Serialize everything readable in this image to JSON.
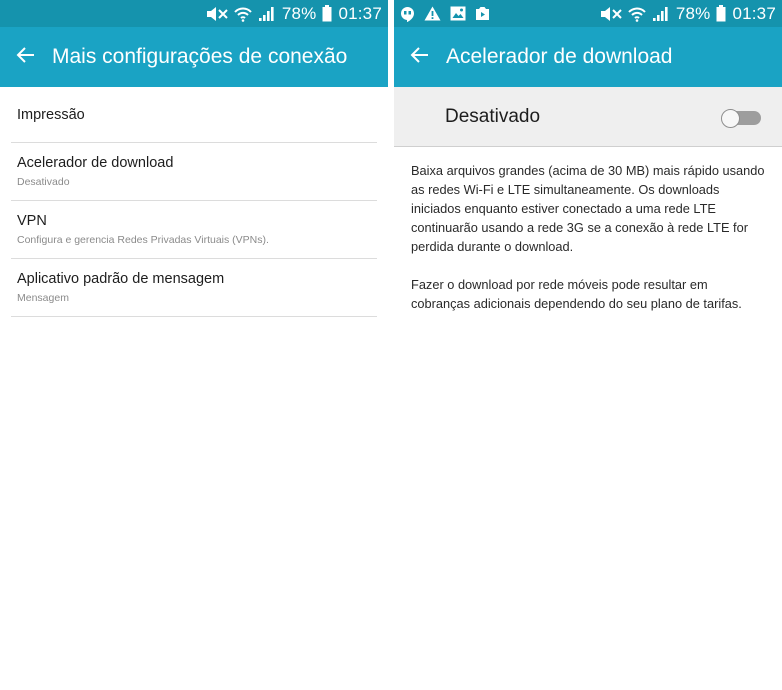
{
  "status_left": {
    "battery_pct": "78%",
    "time": "01:37"
  },
  "status_right": {
    "battery_pct": "78%",
    "time": "01:37",
    "notification_icons": [
      "hangouts-icon",
      "warning-icon",
      "gallery-icon",
      "video-icon"
    ]
  },
  "left_screen": {
    "title": "Mais configurações de conexão",
    "items": [
      {
        "label": "Impressão",
        "sub": ""
      },
      {
        "label": "Acelerador de download",
        "sub": "Desativado"
      },
      {
        "label": "VPN",
        "sub": "Configura e gerencia Redes Privadas Virtuais (VPNs)."
      },
      {
        "label": "Aplicativo padrão de mensagem",
        "sub": "Mensagem"
      }
    ]
  },
  "right_screen": {
    "title": "Acelerador de download",
    "switch_label": "Desativado",
    "switch_on": false,
    "description": [
      "Baixa arquivos grandes (acima de 30 MB) mais rápido usando as redes Wi-Fi e LTE simultaneamente. Os downloads iniciados enquanto estiver conectado a uma rede LTE continuarão usando a rede 3G se a conexão à rede LTE for perdida durante o download.",
      "Fazer o download por rede móveis pode resultar em cobranças adicionais dependendo do seu plano de tarifas."
    ]
  },
  "colors": {
    "status_bar": "#1593ad",
    "app_bar": "#1aa3c4",
    "switch_bar": "#efefef",
    "divider": "#dcdcdc"
  }
}
